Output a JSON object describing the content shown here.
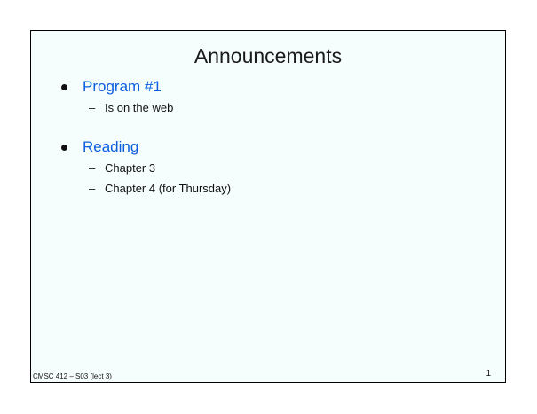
{
  "slide": {
    "title": "Announcements",
    "bullets": [
      {
        "label": "Program #1",
        "subitems": [
          "Is on the web"
        ]
      },
      {
        "label": "Reading",
        "subitems": [
          "Chapter 3",
          "Chapter 4 (for Thursday)"
        ]
      }
    ],
    "dash": "–",
    "footer_left": "CMSC 412 – S03  (lect 3)",
    "page_number": "1"
  },
  "colors": {
    "bullet_heading": "#0b5ee0",
    "background": "#f6fdfd"
  }
}
